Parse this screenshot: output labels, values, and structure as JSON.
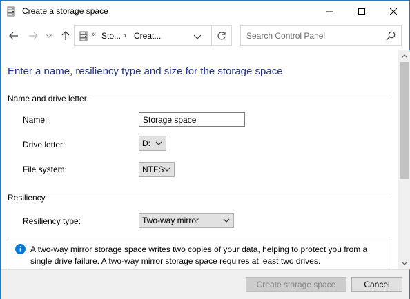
{
  "window": {
    "title": "Create a storage space",
    "icon": "storage-spaces-icon",
    "controls": [
      "minimize-icon",
      "maximize-icon",
      "close-icon"
    ]
  },
  "navigation": {
    "back_icon": "arrow-left-icon",
    "forward_icon": "arrow-right-icon",
    "recent_icon": "chevron-down-icon",
    "up_icon": "arrow-up-icon",
    "address": {
      "overflow": "«",
      "crumb1": "Sto...",
      "separator": "›",
      "crumb2": "Creat..."
    },
    "refresh_icon": "refresh-icon",
    "search": {
      "placeholder": "Search Control Panel",
      "value": ""
    }
  },
  "main": {
    "heading": "Enter a name, resiliency type and size for the storage space",
    "name_section": {
      "title": "Name and drive letter",
      "name_label": "Name:",
      "name_value": "Storage space",
      "drive_label": "Drive letter:",
      "drive_value": "D:",
      "fs_label": "File system:",
      "fs_value": "NTFS"
    },
    "resiliency_section": {
      "title": "Resiliency",
      "type_label": "Resiliency type:",
      "type_value": "Two-way mirror",
      "info_text": "A two-way mirror storage space writes two copies of your data, helping to protect you from a single drive failure. A two-way mirror storage space requires at least two drives."
    }
  },
  "footer": {
    "create_label": "Create storage space",
    "cancel_label": "Cancel"
  },
  "colors": {
    "heading": "#1e3287",
    "info_icon": "#0078d7",
    "window_border": "#2b78b8"
  }
}
